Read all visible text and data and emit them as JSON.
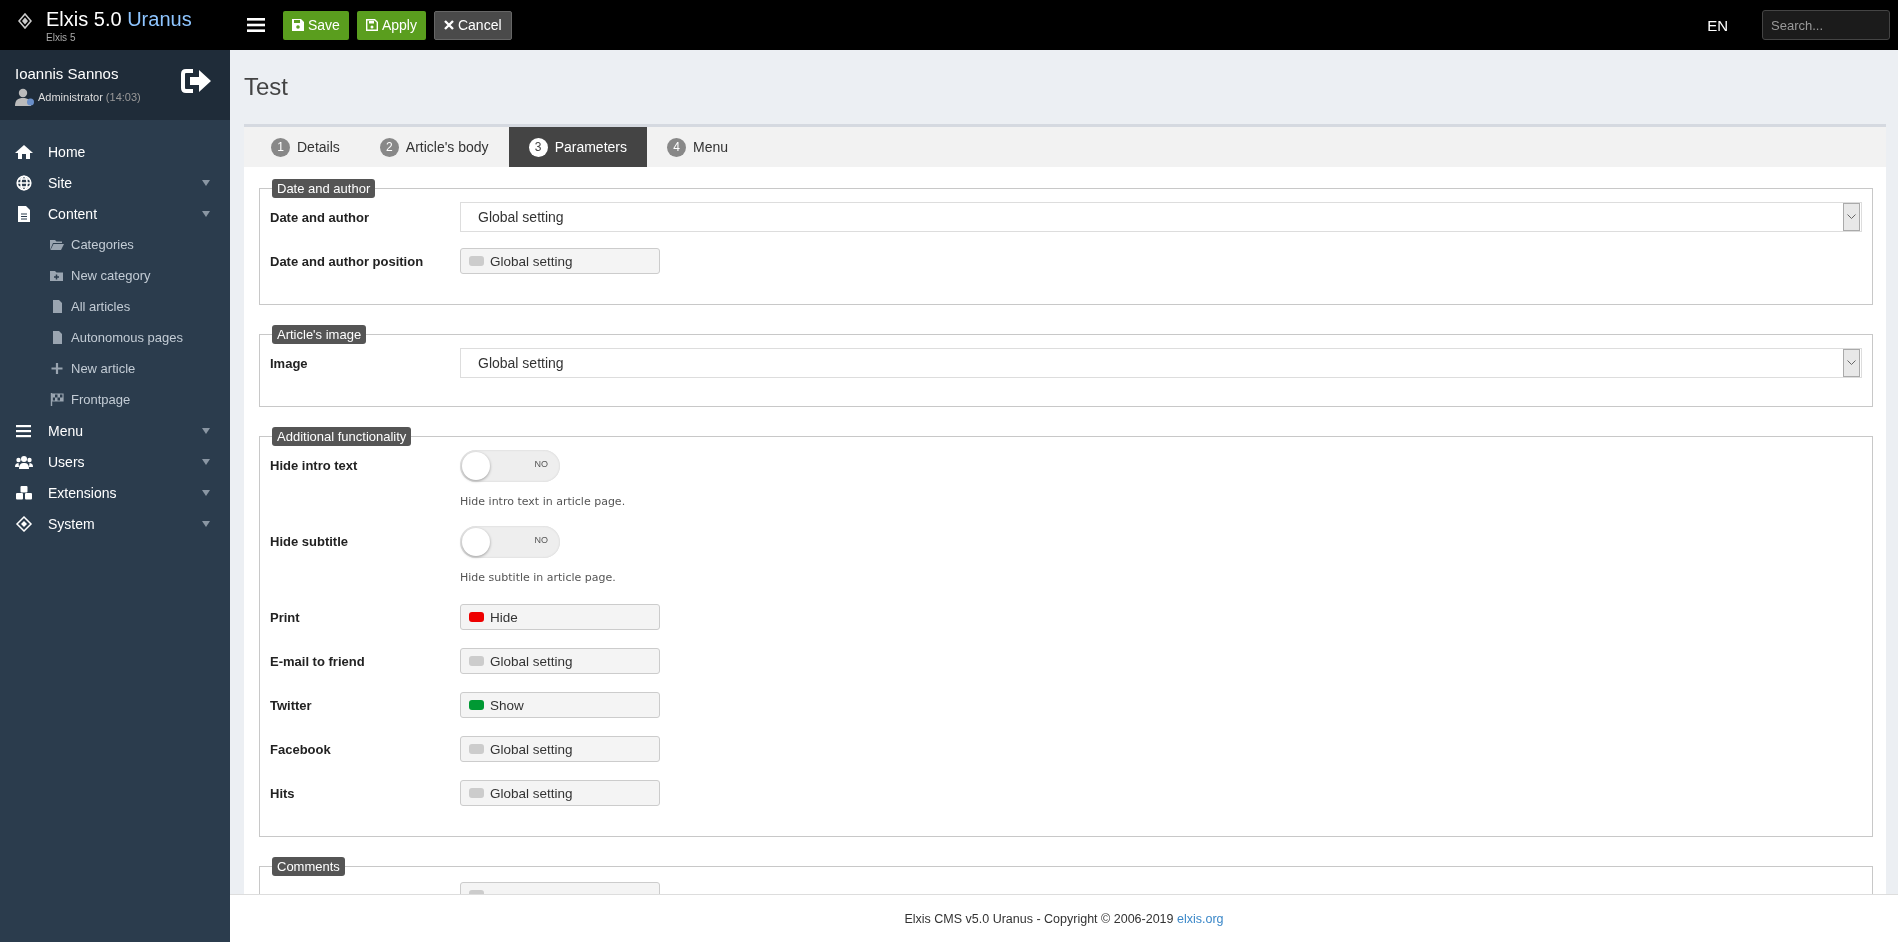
{
  "header": {
    "logo_title": "Elxis 5.0",
    "logo_accent": "Uranus",
    "logo_subtitle": "Elxis 5",
    "buttons": [
      {
        "kind": "save",
        "label": "Save"
      },
      {
        "kind": "apply",
        "label": "Apply"
      },
      {
        "kind": "cancel",
        "label": "Cancel"
      }
    ],
    "language": "EN",
    "search": {
      "placeholder": "Search..."
    }
  },
  "user": {
    "name": "Ioannis Sannos",
    "role": "Administrator",
    "time": "(14:03)"
  },
  "sidebar": {
    "items": [
      {
        "label": "Home",
        "expandable": false
      },
      {
        "label": "Site",
        "expandable": true
      },
      {
        "label": "Content",
        "expandable": true,
        "children": [
          {
            "label": "Categories"
          },
          {
            "label": "New category"
          },
          {
            "label": "All articles"
          },
          {
            "label": "Autonomous pages"
          },
          {
            "label": "New article"
          },
          {
            "label": "Frontpage"
          }
        ]
      },
      {
        "label": "Menu",
        "expandable": true
      },
      {
        "label": "Users",
        "expandable": true
      },
      {
        "label": "Extensions",
        "expandable": true
      },
      {
        "label": "System",
        "expandable": true
      }
    ]
  },
  "page_title": "Test",
  "tabs": [
    {
      "number": "1",
      "label": "Details",
      "selected": false
    },
    {
      "number": "2",
      "label": "Article's body",
      "selected": false
    },
    {
      "number": "3",
      "label": "Parameters",
      "selected": true
    },
    {
      "number": "4",
      "label": "Menu",
      "selected": false
    }
  ],
  "fieldsets": [
    {
      "legend": "Date and author",
      "fields": [
        {
          "kind": "select",
          "label": "Date and author",
          "value": "Global setting"
        },
        {
          "kind": "pill",
          "label": "Date and author position",
          "value": "Global setting",
          "color": "#cccccc"
        }
      ]
    },
    {
      "legend": "Article's image",
      "fields": [
        {
          "kind": "select",
          "label": "Image",
          "value": "Global setting"
        }
      ]
    },
    {
      "legend": "Additional functionality",
      "fields": [
        {
          "kind": "toggle",
          "label": "Hide intro text",
          "on": false,
          "state_label": "NO",
          "help": "Hide intro text in article page."
        },
        {
          "kind": "toggle",
          "label": "Hide subtitle",
          "on": false,
          "state_label": "NO",
          "help": "Hide subtitle in article page."
        },
        {
          "kind": "pill",
          "label": "Print",
          "value": "Hide",
          "color": "#ee0000"
        },
        {
          "kind": "pill",
          "label": "E-mail to friend",
          "value": "Global setting",
          "color": "#cccccc"
        },
        {
          "kind": "pill",
          "label": "Twitter",
          "value": "Show",
          "color": "#009933"
        },
        {
          "kind": "pill",
          "label": "Facebook",
          "value": "Global setting",
          "color": "#cccccc"
        },
        {
          "kind": "pill",
          "label": "Hits",
          "value": "Global setting",
          "color": "#cccccc"
        }
      ]
    },
    {
      "legend": "Comments",
      "fields": [
        {
          "kind": "pill",
          "color": "#cccccc"
        }
      ]
    }
  ],
  "footer": {
    "text": "Elxis CMS v5.0 Uranus - Copyright © 2006-2019 ",
    "link": "elxis.org"
  }
}
